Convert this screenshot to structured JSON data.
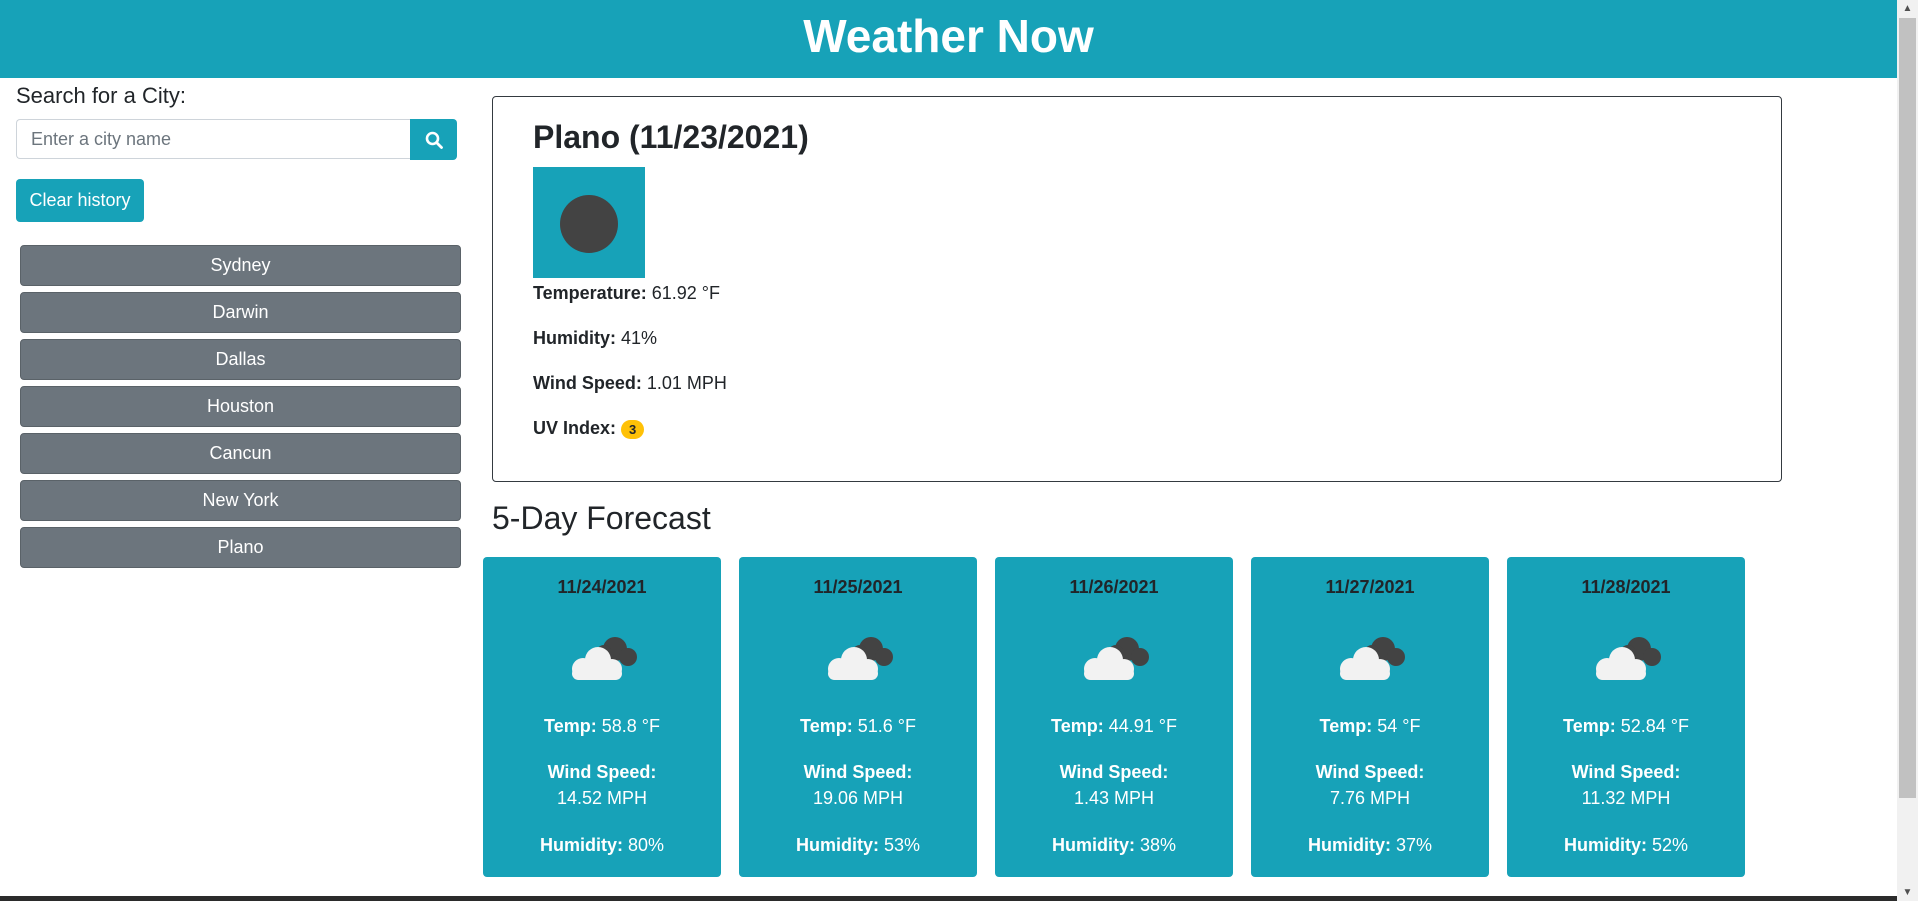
{
  "header": {
    "title": "Weather Now"
  },
  "search": {
    "label": "Search for a City:",
    "placeholder": "Enter a city name",
    "value": "",
    "button_icon": "search-icon"
  },
  "clear_history_label": "Clear history",
  "history": [
    "Sydney",
    "Darwin",
    "Dallas",
    "Houston",
    "Cancun",
    "New York",
    "Plano"
  ],
  "current": {
    "title": "Plano (11/23/2021)",
    "icon": "weather-icon",
    "temperature_label": "Temperature:",
    "temperature": "61.92 °F",
    "humidity_label": "Humidity:",
    "humidity": "41%",
    "wind_label": "Wind Speed:",
    "wind": "1.01 MPH",
    "uv_label": "UV Index:",
    "uv": "3",
    "uv_color": "#ffc107"
  },
  "forecast": {
    "title": "5-Day Forecast",
    "temp_label": "Temp:",
    "wind_label": "Wind Speed:",
    "humidity_label": "Humidity:",
    "days": [
      {
        "date": "11/24/2021",
        "icon": "cloudy-icon",
        "temp": "58.8 °F",
        "wind": "14.52 MPH",
        "humidity": "80%"
      },
      {
        "date": "11/25/2021",
        "icon": "cloudy-icon",
        "temp": "51.6 °F",
        "wind": "19.06 MPH",
        "humidity": "53%"
      },
      {
        "date": "11/26/2021",
        "icon": "cloudy-icon",
        "temp": "44.91 °F",
        "wind": "1.43 MPH",
        "humidity": "38%"
      },
      {
        "date": "11/27/2021",
        "icon": "cloudy-icon",
        "temp": "54 °F",
        "wind": "7.76 MPH",
        "humidity": "37%"
      },
      {
        "date": "11/28/2021",
        "icon": "cloudy-icon",
        "temp": "52.84 °F",
        "wind": "11.32 MPH",
        "humidity": "52%"
      }
    ]
  },
  "colors": {
    "accent": "#17a2b8",
    "history_button": "#6c757d",
    "uv_moderate": "#ffc107"
  }
}
